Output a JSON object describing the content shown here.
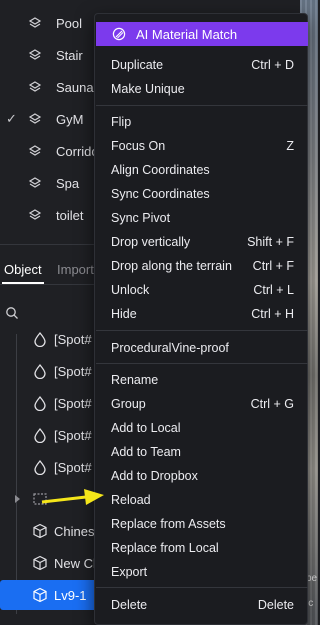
{
  "layers": [
    {
      "label": "Pool",
      "checked": false
    },
    {
      "label": "Stair",
      "checked": false
    },
    {
      "label": "Sauna",
      "checked": false
    },
    {
      "label": "GyM",
      "checked": true
    },
    {
      "label": "Corrido",
      "checked": false
    },
    {
      "label": "Spa",
      "checked": false
    },
    {
      "label": "toilet",
      "checked": false
    }
  ],
  "tabs": {
    "object": "Object",
    "import": "Import"
  },
  "objects": [
    {
      "label": "[Spot#",
      "icon": "drop-icon"
    },
    {
      "label": "[Spot#",
      "icon": "drop-icon"
    },
    {
      "label": "[Spot#",
      "icon": "drop-icon"
    },
    {
      "label": "[Spot#",
      "icon": "drop-icon"
    },
    {
      "label": "[Spot#",
      "icon": "drop-icon"
    },
    {
      "label": "",
      "icon": "group-icon"
    },
    {
      "label": "Chines",
      "icon": "cube-icon"
    },
    {
      "label": "New Cl",
      "icon": "cube-icon"
    },
    {
      "label": "Lv9-1",
      "icon": "cube-icon"
    }
  ],
  "menu": {
    "header": "AI Material Match",
    "items": [
      {
        "label": "Duplicate",
        "shortcut": "Ctrl + D"
      },
      {
        "label": "Make Unique",
        "shortcut": ""
      },
      {
        "label": "Flip",
        "shortcut": ""
      },
      {
        "label": "Focus On",
        "shortcut": "Z"
      },
      {
        "label": "Align Coordinates",
        "shortcut": ""
      },
      {
        "label": "Sync Coordinates",
        "shortcut": ""
      },
      {
        "label": "Sync Pivot",
        "shortcut": ""
      },
      {
        "label": "Drop vertically",
        "shortcut": "Shift + F"
      },
      {
        "label": "Drop along the terrain",
        "shortcut": "Ctrl + F"
      },
      {
        "label": "Unlock",
        "shortcut": "Ctrl + L"
      },
      {
        "label": "Hide",
        "shortcut": "Ctrl + H"
      },
      {
        "label": "ProceduralVine-proof",
        "shortcut": ""
      },
      {
        "label": "Rename",
        "shortcut": ""
      },
      {
        "label": "Group",
        "shortcut": "Ctrl + G"
      },
      {
        "label": "Add to Local",
        "shortcut": ""
      },
      {
        "label": "Add to Team",
        "shortcut": ""
      },
      {
        "label": "Add to Dropbox",
        "shortcut": ""
      },
      {
        "label": "Reload",
        "shortcut": ""
      },
      {
        "label": "Replace from Assets",
        "shortcut": ""
      },
      {
        "label": "Replace from Local",
        "shortcut": ""
      },
      {
        "label": "Export",
        "shortcut": ""
      },
      {
        "label": "Delete",
        "shortcut": "Delete"
      }
    ]
  },
  "strip": {
    "text1": "pe",
    "text2": "ic"
  },
  "colors": {
    "accent_purple": "#7c3aed",
    "selection_blue": "#1a6ef2",
    "arrow_yellow": "#f5e61a"
  }
}
